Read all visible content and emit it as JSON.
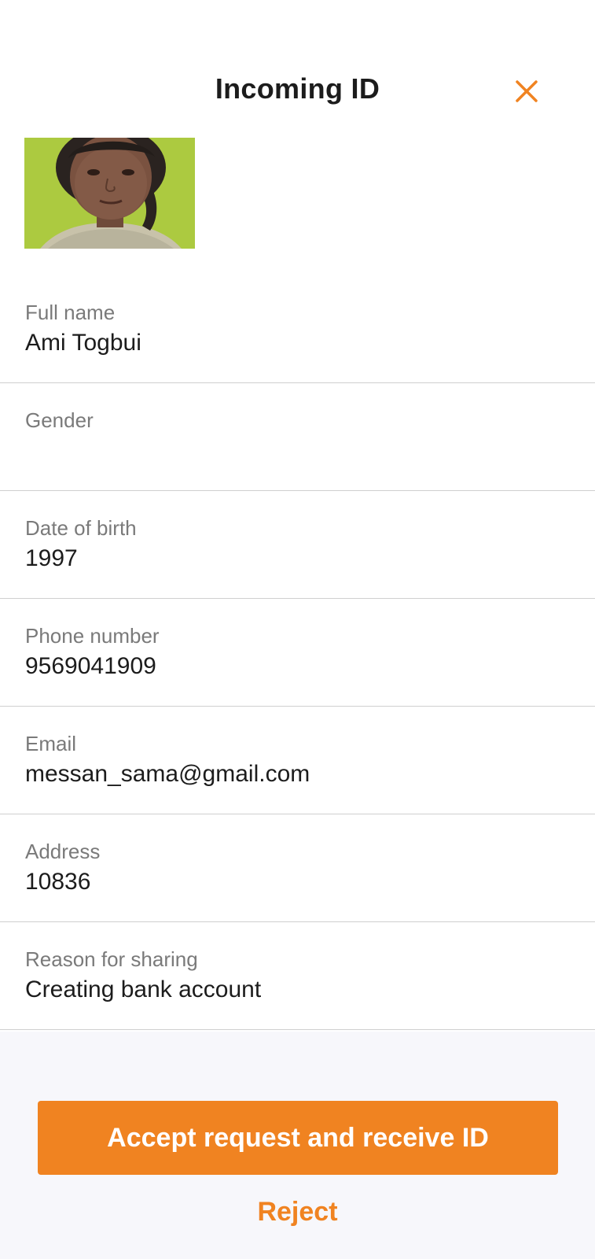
{
  "header": {
    "title": "Incoming ID",
    "close_icon": "close-icon"
  },
  "photo": {
    "icon": "profile-photo"
  },
  "fields": [
    {
      "label": "Full name",
      "value": "Ami Togbui"
    },
    {
      "label": "Gender",
      "value": ""
    },
    {
      "label": "Date of birth",
      "value": "1997"
    },
    {
      "label": "Phone number",
      "value": "9569041909"
    },
    {
      "label": "Email",
      "value": "messan_sama@gmail.com"
    },
    {
      "label": "Address",
      "value": "10836"
    },
    {
      "label": "Reason for sharing",
      "value": "Creating bank account"
    }
  ],
  "actions": {
    "accept_label": "Accept request and receive ID",
    "reject_label": "Reject"
  },
  "colors": {
    "accent": "#f08321",
    "footer_bg": "#f7f7fb"
  }
}
